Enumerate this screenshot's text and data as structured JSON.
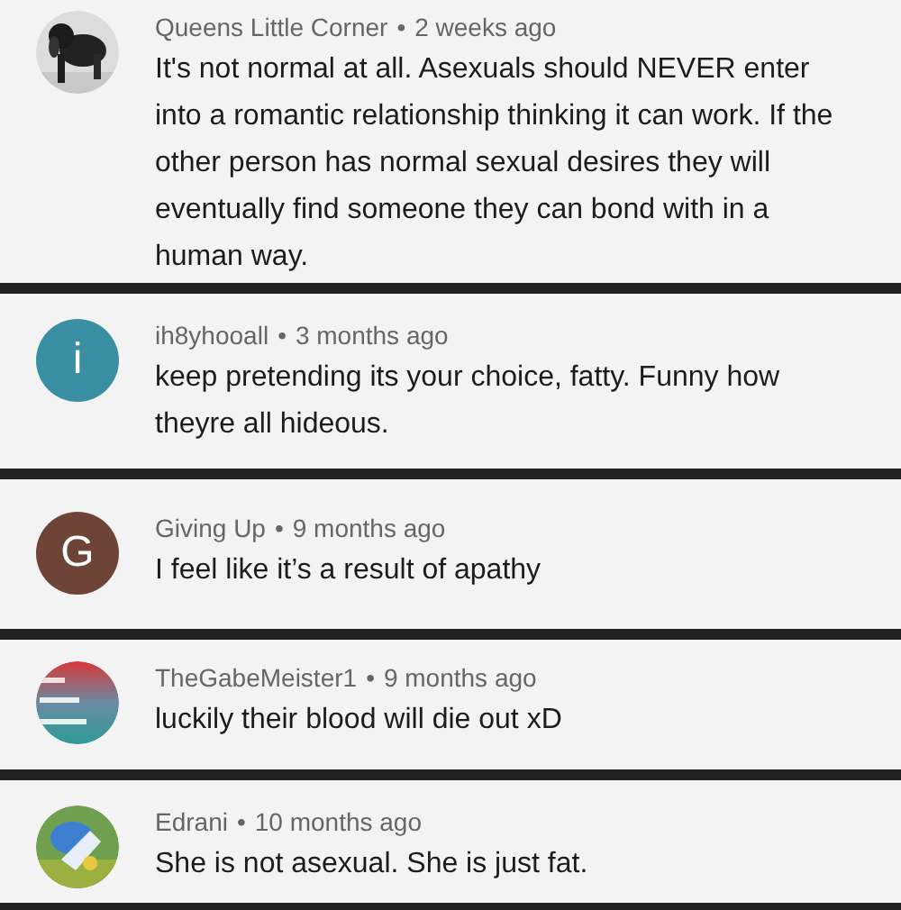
{
  "comments": [
    {
      "author": "Queens Little Corner",
      "separator": "•",
      "time": "2 weeks ago",
      "text": "It's not normal at all. Asexuals should NEVER enter into a romantic relationship thinking it can work. If the other person has normal sexual desires they will eventually find someone they can bond with in a human way."
    },
    {
      "author": "ih8yhooall",
      "separator": "•",
      "time": "3 months ago",
      "text": "keep pretending its your choice, fatty. Funny how theyre all hideous.",
      "avatar": {
        "kind": "letter",
        "letter": "i",
        "color": "#3b8fa3"
      }
    },
    {
      "author": "Giving Up",
      "separator": "•",
      "time": "9 months ago",
      "text": "I feel like it’s a result of apathy",
      "avatar": {
        "kind": "letter",
        "letter": "G",
        "color": "#6d4437"
      }
    },
    {
      "author": "TheGabeMeister1",
      "separator": "•",
      "time": "9 months ago",
      "text": "luckily their blood will die out xD"
    },
    {
      "author": "Edrani",
      "separator": "•",
      "time": "10 months ago",
      "text": "She is not asexual. She is just fat."
    }
  ]
}
